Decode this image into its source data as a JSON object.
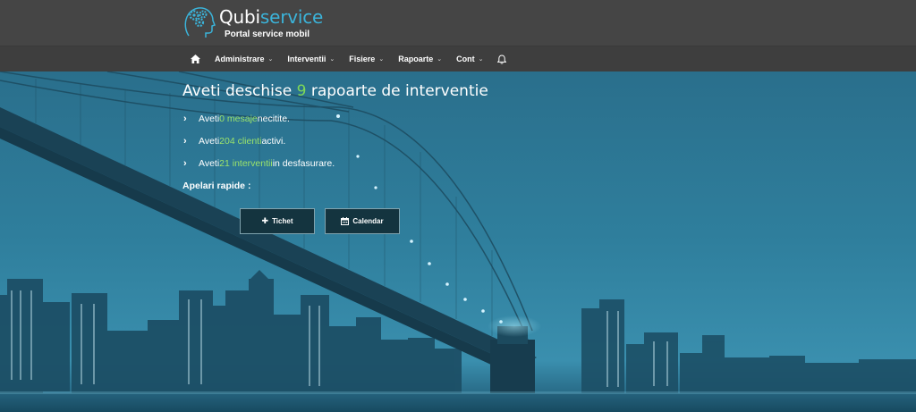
{
  "brand": {
    "name_main": "Qubi",
    "name_accent": "service",
    "subtitle": "Portal service mobil",
    "logo_icon": "gears-head-icon"
  },
  "nav": {
    "home_icon": "home-icon",
    "items": [
      {
        "label": "Administrare"
      },
      {
        "label": "Interventii"
      },
      {
        "label": "Fisiere"
      },
      {
        "label": "Rapoarte"
      },
      {
        "label": "Cont"
      }
    ],
    "bell_icon": "bell-icon"
  },
  "hero": {
    "headline_pre": "Aveti deschise ",
    "headline_count": "9",
    "headline_post": " rapoarte de interventie",
    "stats": [
      {
        "pre": "Aveti ",
        "link": "0 mesaje",
        "post": " necitite."
      },
      {
        "pre": "Aveti ",
        "link": "204 clienti",
        "post": " activi."
      },
      {
        "pre": "Aveti ",
        "link": "21 interventii",
        "post": " in desfasurare."
      }
    ],
    "quick_title": "Apelari rapide :",
    "buttons": [
      {
        "label": "Tichet",
        "icon": "plus-icon"
      },
      {
        "label": "Calendar",
        "icon": "calendar-icon"
      }
    ]
  },
  "colors": {
    "header_bg": "#454545",
    "nav_bg": "#3e3e3e",
    "accent_blue": "#3bb3d9",
    "highlight_green": "#7ed957",
    "hero_bg": "#1d5f7a"
  }
}
